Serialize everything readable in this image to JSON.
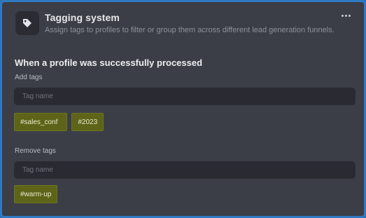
{
  "header": {
    "icon": "tag-icon",
    "title": "Tagging system",
    "subtitle": "Assign tags to profiles to filter or group them across different lead generation funnels.",
    "menu_icon": "more-horizontal-icon"
  },
  "section": {
    "title": "When a profile was successfully processed"
  },
  "add_tags": {
    "label": "Add tags",
    "placeholder": "Tag name",
    "tags": [
      "#sales_conf",
      "#2023"
    ]
  },
  "remove_tags": {
    "label": "Remove tags",
    "placeholder": "Tag name",
    "tags": [
      "#warm-up"
    ]
  },
  "colors": {
    "card_background": "#3c3e47",
    "input_background": "#2a2b32",
    "tag_background": "#5d6318",
    "frame_border": "#2f79c4"
  }
}
